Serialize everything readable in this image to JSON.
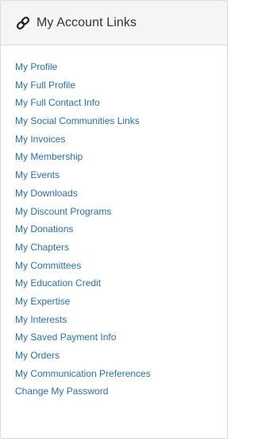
{
  "panel": {
    "title": "My Account Links",
    "title_icon": "link-icon",
    "link_color": "#2a6fb0",
    "links": [
      {
        "label": "My Profile"
      },
      {
        "label": "My Full Profile"
      },
      {
        "label": "My Full Contact Info"
      },
      {
        "label": "My Social Communities Links"
      },
      {
        "label": "My Invoices"
      },
      {
        "label": "My Membership"
      },
      {
        "label": "My Events"
      },
      {
        "label": "My Downloads"
      },
      {
        "label": "My Discount Programs"
      },
      {
        "label": "My Donations"
      },
      {
        "label": "My Chapters"
      },
      {
        "label": "My Committees"
      },
      {
        "label": "My Education Credit"
      },
      {
        "label": "My Expertise"
      },
      {
        "label": "My Interests"
      },
      {
        "label": "My Saved Payment Info"
      },
      {
        "label": "My Orders"
      },
      {
        "label": "My Communication Preferences"
      },
      {
        "label": "Change My Password"
      }
    ]
  }
}
